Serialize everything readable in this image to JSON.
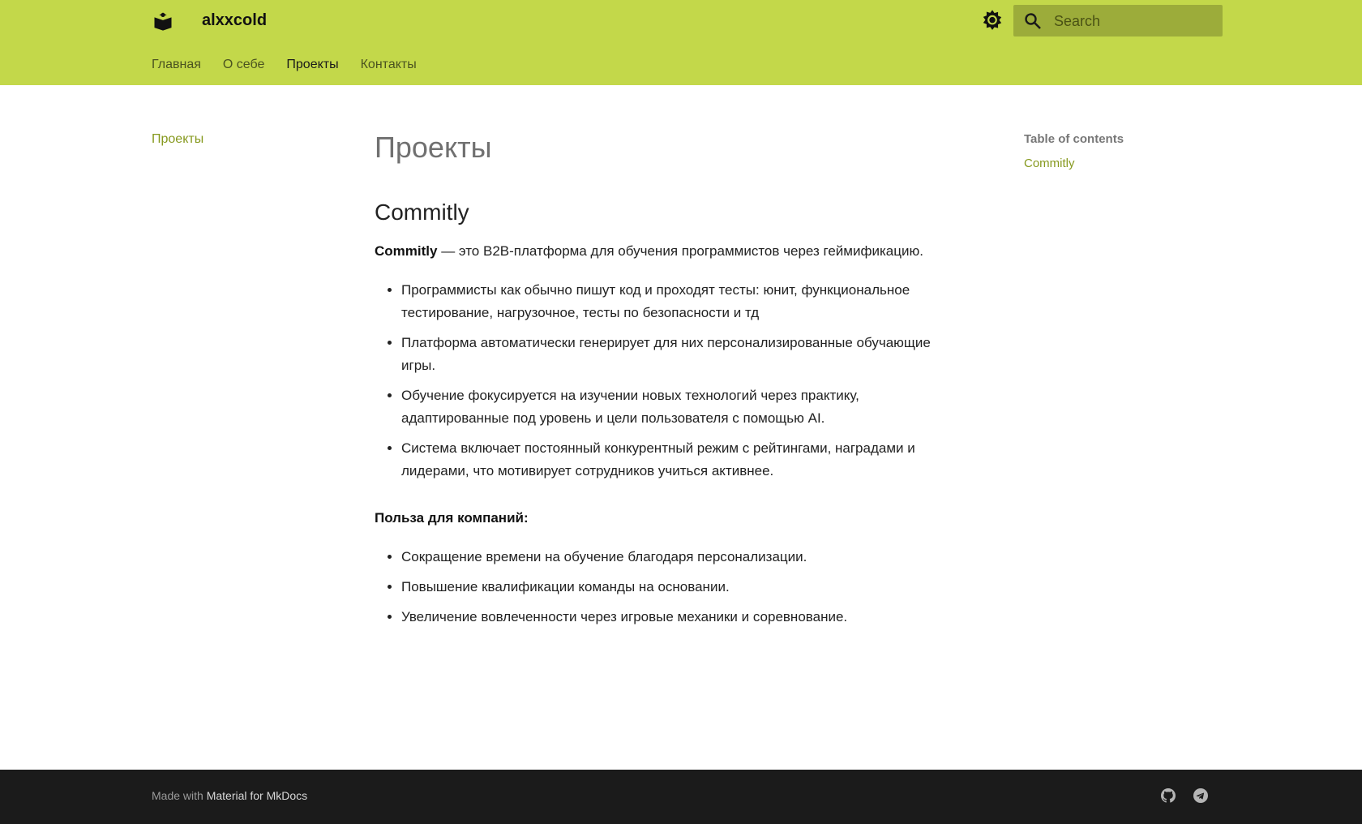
{
  "header": {
    "site_name": "alxxcold",
    "search_placeholder": "Search",
    "tabs": [
      "Главная",
      "О себе",
      "Проекты",
      "Контакты"
    ],
    "active_tab": "Проекты",
    "colors": {
      "primary": "#c3d84a",
      "search_bg": "#9cac3a",
      "accent": "#86991e"
    }
  },
  "nav": {
    "items": [
      "Проекты"
    ]
  },
  "main": {
    "title": "Проекты",
    "section_title": "Commitly",
    "intro_bold": "Commitly",
    "intro_rest": " — это B2B-платформа для обучения программистов через геймификацию.",
    "bullets": [
      "Программисты как обычно пишут код и проходят тесты: юнит, функциональное тестирование, нагрузочное, тесты по безопасности и тд",
      "Платформа автоматически генерирует для них персонализированные обучающие игры.",
      "Обучение фокусируется на изучении новых технологий через практику, адаптированные под уровень и цели пользователя с помощью AI.",
      "Система включает постоянный конкурентный режим с рейтингами, наградами и лидерами, что мотивирует сотрудников учиться активнее."
    ],
    "benefits_heading": "Польза для компаний:",
    "benefits": [
      "Сокращение времени на обучение благодаря персонализации.",
      "Повышение квалификации команды на основании.",
      "Увеличение вовлеченности через игровые механики и соревнование."
    ]
  },
  "toc": {
    "title": "Table of contents",
    "items": [
      "Commitly"
    ]
  },
  "footer": {
    "made_with": "Made with",
    "link": "Material for MkDocs",
    "social_icons": [
      "github-icon",
      "telegram-icon"
    ]
  }
}
